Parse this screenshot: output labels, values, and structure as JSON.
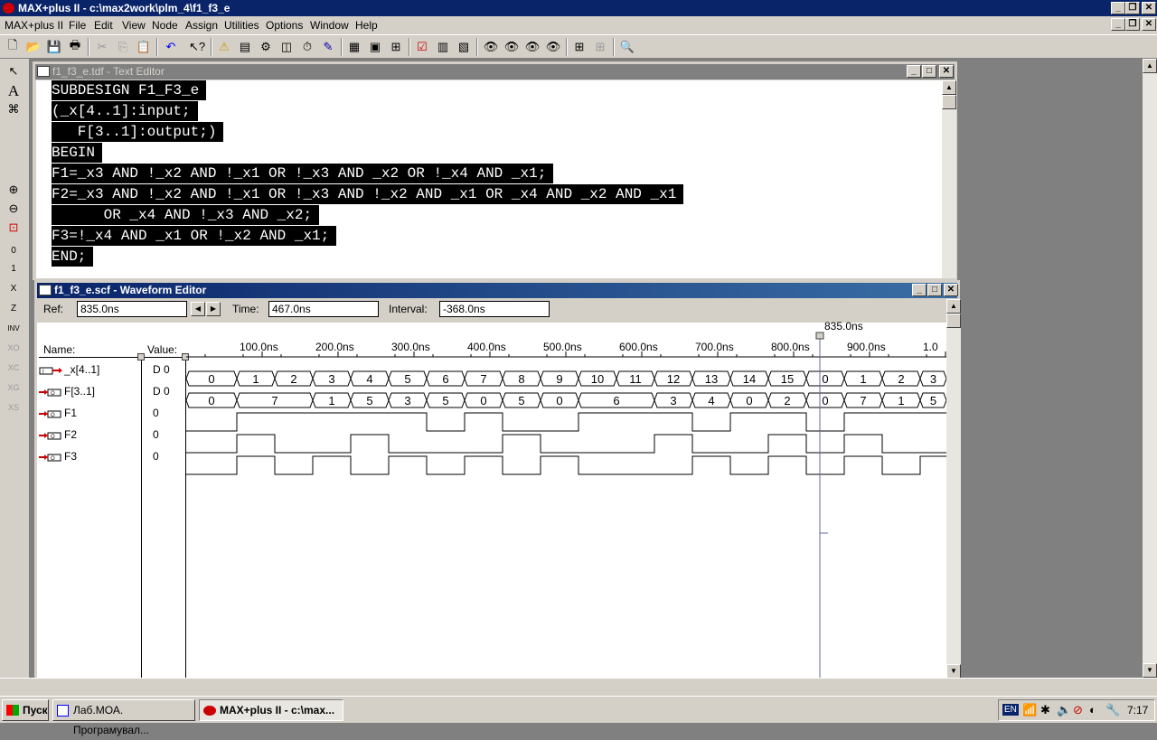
{
  "app": {
    "title": "MAX+plus II - c:\\max2work\\plm_4\\f1_f3_e",
    "accent": "#0a246a"
  },
  "menu": [
    "MAX+plus II",
    "File",
    "Edit",
    "View",
    "Node",
    "Assign",
    "Utilities",
    "Options",
    "Window",
    "Help"
  ],
  "text_editor": {
    "title": "f1_f3_e.tdf - Text Editor",
    "lines": [
      "SUBDESIGN F1_F3_e",
      "(_x[4..1]:input;",
      "   F[3..1]:output;)",
      "BEGIN",
      "F1=_x3 AND !_x2 AND !_x1 OR !_x3 AND _x2 OR !_x4 AND _x1;",
      "F2=_x3 AND !_x2 AND !_x1 OR !_x3 AND !_x2 AND _x1 OR _x4 AND _x2 AND _x1",
      "      OR _x4 AND !_x3 AND _x2;",
      "F3=!_x4 AND _x1 OR !_x2 AND _x1;",
      "END;"
    ]
  },
  "waveform_editor": {
    "title": "f1_f3_e.scf - Waveform Editor",
    "ref_label": "Ref:",
    "ref_value": "835.0ns",
    "time_label": "Time:",
    "time_value": "467.0ns",
    "interval_label": "Interval:",
    "interval_value": "-368.0ns",
    "cursor_label": "835.0ns",
    "name_header": "Name:",
    "value_header": "Value:",
    "time_ticks": [
      "100.0ns",
      "200.0ns",
      "300.0ns",
      "400.0ns",
      "500.0ns",
      "600.0ns",
      "700.0ns",
      "800.0ns",
      "900.0ns",
      "1.0"
    ],
    "nodes": [
      {
        "name": "_x[4..1]",
        "value": "D 0",
        "kind": "bus-input",
        "segments": [
          "0",
          "1",
          "2",
          "3",
          "4",
          "5",
          "6",
          "7",
          "8",
          "9",
          "10",
          "11",
          "12",
          "13",
          "14",
          "15",
          "0",
          "1",
          "2",
          "3"
        ]
      },
      {
        "name": "F[3..1]",
        "value": "D 0",
        "kind": "bus-output",
        "segments": [
          "0",
          "7",
          "1",
          "5",
          "3",
          "5",
          "0",
          "5",
          "0",
          "6",
          "3",
          "3",
          "4",
          "0",
          "2",
          "0",
          "7",
          "1",
          "5"
        ]
      },
      {
        "name": "F1",
        "value": "0",
        "kind": "output"
      },
      {
        "name": "F2",
        "value": "0",
        "kind": "output"
      },
      {
        "name": "F3",
        "value": "0",
        "kind": "output"
      }
    ]
  },
  "taskbar": {
    "start_label": "Пуск",
    "tasks": [
      "Лаб.МОА. Програмувал...",
      "MAX+plus II - c:\\max..."
    ],
    "lang": "EN",
    "clock": "7:17"
  }
}
